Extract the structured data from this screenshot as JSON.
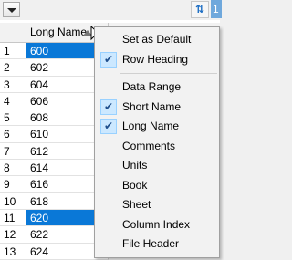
{
  "toolbar": {
    "dropdown_icon": "chevron-down-icon",
    "sort_icon": "sort-arrows-icon",
    "sort_glyph": "⇅",
    "badge": "1"
  },
  "grid": {
    "column_header": "Long Name",
    "rows": [
      {
        "num": "1",
        "value": "600",
        "selected": true
      },
      {
        "num": "2",
        "value": "602",
        "selected": false
      },
      {
        "num": "3",
        "value": "604",
        "selected": false
      },
      {
        "num": "4",
        "value": "606",
        "selected": false
      },
      {
        "num": "5",
        "value": "608",
        "selected": false
      },
      {
        "num": "6",
        "value": "610",
        "selected": false
      },
      {
        "num": "7",
        "value": "612",
        "selected": false
      },
      {
        "num": "8",
        "value": "614",
        "selected": false
      },
      {
        "num": "9",
        "value": "616",
        "selected": false
      },
      {
        "num": "10",
        "value": "618",
        "selected": false
      },
      {
        "num": "11",
        "value": "620",
        "selected": true
      },
      {
        "num": "12",
        "value": "622",
        "selected": false
      },
      {
        "num": "13",
        "value": "624",
        "selected": false
      }
    ]
  },
  "menu": {
    "group1": [
      {
        "label": "Set as Default",
        "checked": false
      },
      {
        "label": "Row Heading",
        "checked": true
      }
    ],
    "group2": [
      {
        "label": "Data Range",
        "checked": false
      },
      {
        "label": "Short Name",
        "checked": true
      },
      {
        "label": "Long Name",
        "checked": true
      },
      {
        "label": "Comments",
        "checked": false
      },
      {
        "label": "Units",
        "checked": false
      },
      {
        "label": "Book",
        "checked": false
      },
      {
        "label": "Sheet",
        "checked": false
      },
      {
        "label": "Column Index",
        "checked": false
      },
      {
        "label": "File Header",
        "checked": false
      }
    ]
  },
  "colors": {
    "selection": "#0a78d7",
    "check_bg": "#cce8ff",
    "badge_bg": "#6fa8dc",
    "sort_icon": "#1f6fc4"
  }
}
